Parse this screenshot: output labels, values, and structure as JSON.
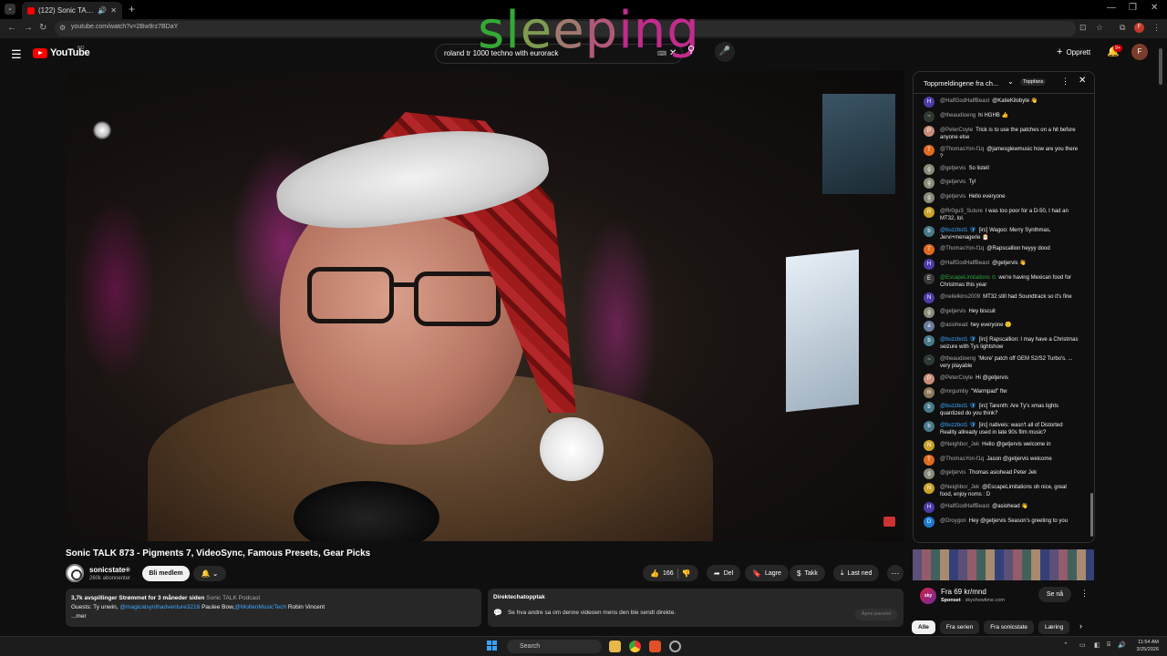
{
  "browser": {
    "tab_title": "(122) Sonic TALK 873 - Pigm",
    "url": "youtube.com/watch?v=2Bw9rz7BDaY",
    "profile_initial": "F"
  },
  "overlay_word": [
    "s",
    "l",
    "e",
    "e",
    "p",
    "i",
    "n",
    "g"
  ],
  "header": {
    "logo_text": "YouTube",
    "region": "NO",
    "search_value": "roland tr 1000 techno with eurorack",
    "create_label": "Opprett",
    "notif_badge": "9+",
    "avatar_initial": "F"
  },
  "video": {
    "title": "Sonic TALK 873 - Pigments 7, VideoSync, Famous Presets, Gear Picks",
    "channel_name": "sonicstate",
    "subscribers": "260k abonnenter",
    "join_label": "Bli medlem",
    "likes": "166",
    "share_label": "Del",
    "save_label": "Lagre",
    "thanks_label": "Takk",
    "download_label": "Last ned"
  },
  "description": {
    "stats": "3,7k avspillinger  Strømmet for 3 måneder siden",
    "podcast": "Sonic TALK Podcast",
    "guests_prefix": "Guests: Ty unwin,",
    "guest_link1": "@magicalsynthadventure3216",
    "guest_mid": "Paulee Bow,",
    "guest_link2": "@MoltenMusicTech",
    "guest_end": "Robin Vincent",
    "more": "...mer"
  },
  "chat_replay": {
    "heading": "Direktechatopptak",
    "text": "Se hva andre sa om denne videoen mens den ble sendt direkte.",
    "button": "Åpne panelet"
  },
  "chat": {
    "title": "Toppmeldingene fra ch...",
    "topfans": "Toppfans",
    "messages": [
      {
        "author": "@HalfGodHalfBeast",
        "text": "@KatieKilobyte 👋",
        "color": "#4e3aa8",
        "initial": "H",
        "style": ""
      },
      {
        "author": "@theaudioeng",
        "text": "hi HGHB 👍",
        "color": "#2f3b32",
        "initial": "~",
        "style": ""
      },
      {
        "author": "@PeterCoyte",
        "text": "Trick is to use the patches on a hit before anyone else",
        "color": "#c78d7a",
        "initial": "P",
        "style": ""
      },
      {
        "author": "@ThomasYon-f1q",
        "text": "@jamesglewmusic how are you there ?",
        "color": "#e06a1f",
        "initial": "T",
        "style": ""
      },
      {
        "author": "@getjervis",
        "text": "So listell",
        "color": "#8a8a7a",
        "initial": "g",
        "style": ""
      },
      {
        "author": "@getjervis",
        "text": "Ty!",
        "color": "#8a8a7a",
        "initial": "g",
        "style": ""
      },
      {
        "author": "@getjervis",
        "text": "Hello everyone",
        "color": "#8a8a7a",
        "initial": "g",
        "style": ""
      },
      {
        "author": "@Rr0gu3_Suture",
        "text": "I was too poor for a D-50, I had an MT32, lol.",
        "color": "#c9a22a",
        "initial": "R",
        "style": ""
      },
      {
        "author": "@buzzbot1 🛡",
        "text": "[irc] Wagoo: Merry Synthmas, Jervi+menagerie 🎅",
        "color": "#4a7a8a",
        "initial": "b",
        "style": "blue"
      },
      {
        "author": "@ThomasYon-f1q",
        "text": "@Rapscallion heyyy dood",
        "color": "#e06a1f",
        "initial": "T",
        "style": ""
      },
      {
        "author": "@HalfGodHalfBeast",
        "text": "@getjervis 👋",
        "color": "#4e3aa8",
        "initial": "H",
        "style": ""
      },
      {
        "author": "@EscapeLimitations ⊙",
        "text": "we're having Mexican food for Christmas this year",
        "color": "#3a3a3a",
        "initial": "E",
        "style": "green"
      },
      {
        "author": "@neilelkins2009",
        "text": "MT32 still had Soundtrack so it's fine",
        "color": "#4e3aa8",
        "initial": "N",
        "style": ""
      },
      {
        "author": "@getjervis",
        "text": "Hey biscuit",
        "color": "#8a8a7a",
        "initial": "g",
        "style": ""
      },
      {
        "author": "@asiohead",
        "text": "hey everyone 🙂",
        "color": "#6a7a9a",
        "initial": "a",
        "style": ""
      },
      {
        "author": "@buzzbot1 🛡",
        "text": "[irc] Rapscallion: I may have a Christmas seizure with Tys lightshow",
        "color": "#4a7a8a",
        "initial": "b",
        "style": "blue"
      },
      {
        "author": "@theaudioeng",
        "text": "'More' patch off GEM S2/S2 Turbo's. ... very playable",
        "color": "#2f3b32",
        "initial": "~",
        "style": ""
      },
      {
        "author": "@PeterCoyte",
        "text": "Hi @getjervis",
        "color": "#c78d7a",
        "initial": "P",
        "style": ""
      },
      {
        "author": "@mrgumby",
        "text": "\"Warmpad\" ftw",
        "color": "#8a7a5a",
        "initial": "m",
        "style": ""
      },
      {
        "author": "@buzzbot1 🛡",
        "text": "[irc] Tarenth: Are Ty's xmas lights quantized do you think?",
        "color": "#4a7a8a",
        "initial": "b",
        "style": "blue"
      },
      {
        "author": "@buzzbot1 🛡",
        "text": "[irc] nativeis: wasn't all of Distorted Reality allready used in late 90s film music?",
        "color": "#4a7a8a",
        "initial": "b",
        "style": "blue"
      },
      {
        "author": "@Neighbor_Jek",
        "text": "Hello @getjervis welcome in",
        "color": "#c9a22a",
        "initial": "N",
        "style": ""
      },
      {
        "author": "@ThomasYon-f1q",
        "text": "Jason @getjervis welcome",
        "color": "#e06a1f",
        "initial": "T",
        "style": ""
      },
      {
        "author": "@getjervis",
        "text": "Thomas asiohead Peter Jek",
        "color": "#8a8a7a",
        "initial": "g",
        "style": ""
      },
      {
        "author": "@Neighbor_Jek",
        "text": "@EscapeLimitations oh nice, great food, enjoy noms : D",
        "color": "#c9a22a",
        "initial": "N",
        "style": ""
      },
      {
        "author": "@HalfGodHalfBeast",
        "text": "@asiohead 👋",
        "color": "#4e3aa8",
        "initial": "H",
        "style": ""
      },
      {
        "author": "@Droygon",
        "text": "Hey @getjervis Season's greeting to you",
        "color": "#1e7ad0",
        "initial": "D",
        "style": ""
      }
    ]
  },
  "ad": {
    "logo": "sky",
    "title": "Fra 69 kr/mnd",
    "sponsor_label": "Sponset",
    "sponsor_domain": "skyshowtime.com",
    "button": "Se nå"
  },
  "chips": [
    "Alle",
    "Fra serien",
    "Fra sonicstate",
    "Læring"
  ],
  "taskbar": {
    "search": "Search",
    "time": "11:54 AM",
    "date": "3/25/2026"
  }
}
